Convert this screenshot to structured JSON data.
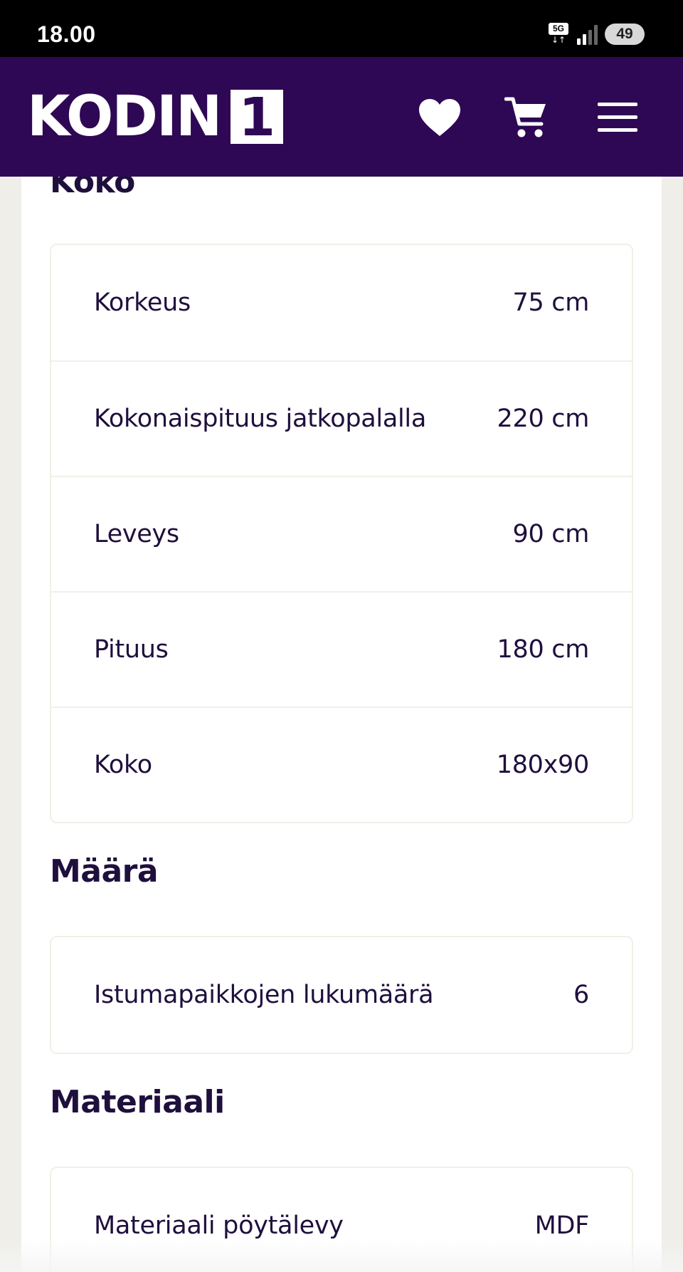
{
  "status_bar": {
    "time": "18.00",
    "network": "5G",
    "network_arrows": "↓↑",
    "battery": "49"
  },
  "header": {
    "logo_text": "KODIN",
    "logo_number": "1",
    "icons": [
      "heart-icon",
      "cart-icon",
      "hamburger-menu-icon"
    ],
    "background_color": "#2e0854"
  },
  "sections": {
    "koko": {
      "title": "Koko",
      "rows": [
        {
          "label": "Korkeus",
          "value": "75 cm"
        },
        {
          "label": "Kokonaispituus jatkopalalla",
          "value": "220 cm"
        },
        {
          "label": "Leveys",
          "value": "90 cm"
        },
        {
          "label": "Pituus",
          "value": "180 cm"
        },
        {
          "label": "Koko",
          "value": "180x90"
        }
      ]
    },
    "maara": {
      "title": "Määrä",
      "rows": [
        {
          "label": "Istumapaikkojen lukumäärä",
          "value": "6"
        }
      ]
    },
    "materiaali": {
      "title": "Materiaali",
      "rows": [
        {
          "label": "Materiaali pöytälevy",
          "value": "MDF"
        }
      ]
    }
  }
}
